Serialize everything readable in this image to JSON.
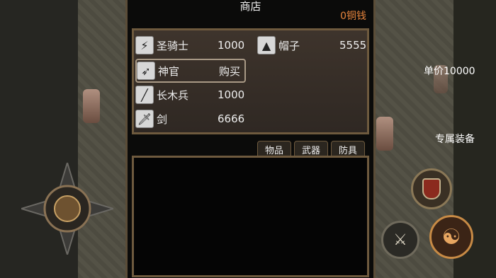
{
  "shop": {
    "title": "商店",
    "currency": "0铜钱",
    "items": [
      {
        "icon": "lightning-icon",
        "name": "圣骑士",
        "price": "1000"
      },
      {
        "icon": "bow-icon",
        "name": "神官",
        "action": "购买"
      },
      {
        "icon": "staff-icon",
        "name": "长木兵",
        "price": "1000"
      },
      {
        "icon": "sword-icon",
        "name": "剑",
        "price": "6666"
      },
      {
        "icon": "hat-icon",
        "name": "帽子",
        "price": "5555"
      }
    ],
    "tabs": [
      "物品",
      "武器",
      "防具"
    ]
  },
  "side": {
    "unit_price": "单价10000",
    "exclusive_equipment": "专属装备"
  }
}
